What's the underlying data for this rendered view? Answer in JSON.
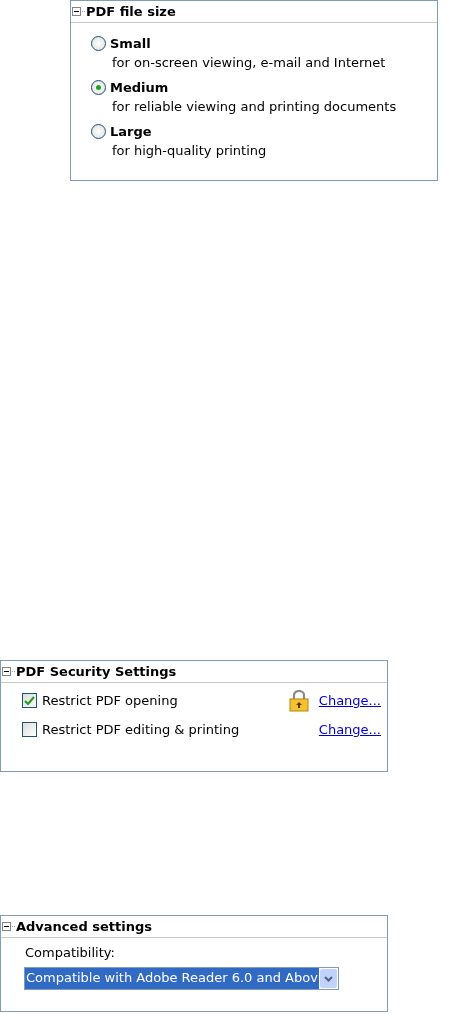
{
  "file_size": {
    "title": "PDF file size",
    "expanded": true,
    "options": [
      {
        "label": "Small",
        "description": "for on-screen viewing, e-mail and Internet",
        "selected": false
      },
      {
        "label": "Medium",
        "description": "for reliable viewing and printing documents",
        "selected": true
      },
      {
        "label": "Large",
        "description": "for high-quality printing",
        "selected": false
      }
    ]
  },
  "security": {
    "title": "PDF Security Settings",
    "expanded": true,
    "items": [
      {
        "label": "Restrict PDF opening",
        "checked": true,
        "locked": true,
        "link": "Change..."
      },
      {
        "label": "Restrict PDF editing & printing",
        "checked": false,
        "locked": false,
        "link": "Change..."
      }
    ]
  },
  "advanced": {
    "title": "Advanced settings",
    "expanded": true,
    "compatibility_label": "Compatibility:",
    "compatibility_value": "Compatible with Adobe Reader 6.0 and Abov"
  }
}
